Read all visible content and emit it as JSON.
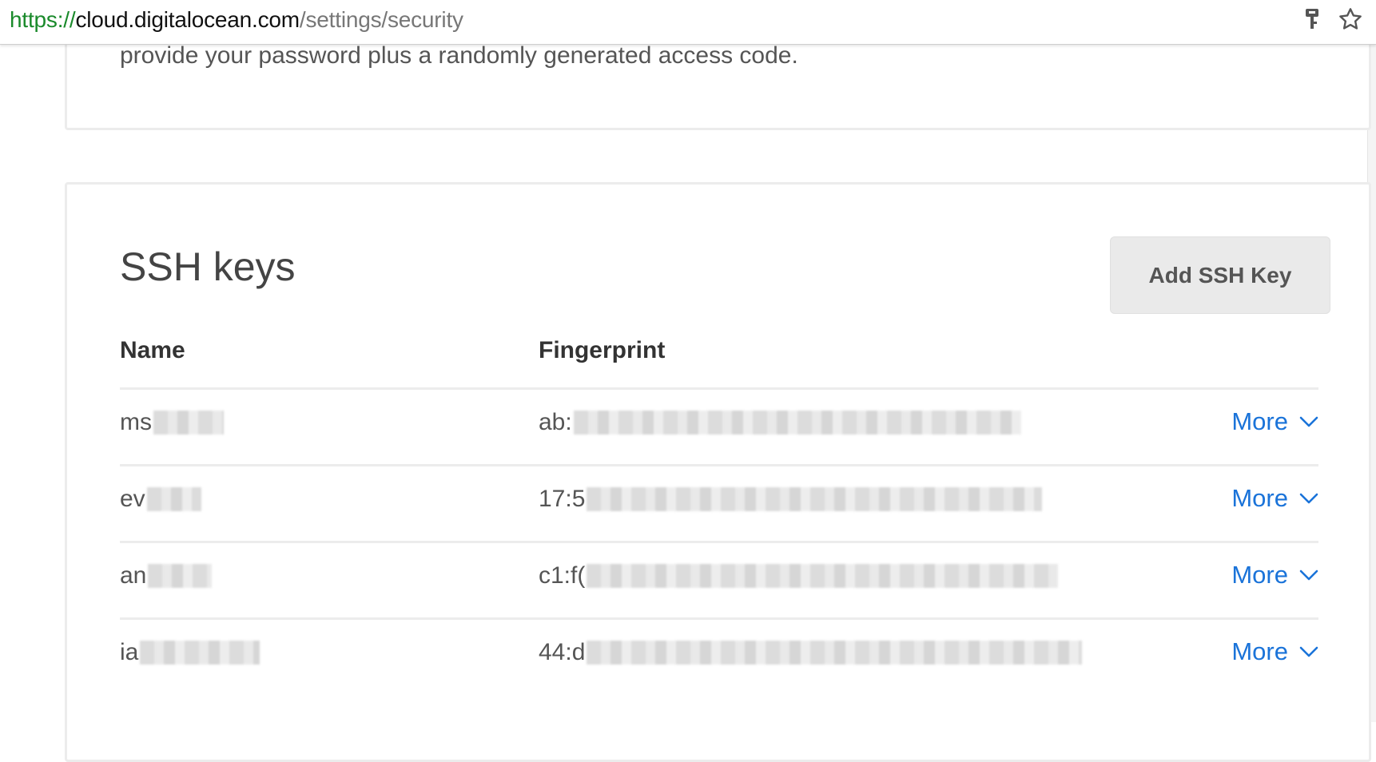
{
  "browser": {
    "url_scheme": "https://",
    "url_host": "cloud.digitalocean.com",
    "url_path": "/settings/security",
    "icons": [
      "key-icon",
      "star-icon"
    ]
  },
  "two_factor": {
    "description": "provide your password plus a randomly generated access code."
  },
  "ssh_keys": {
    "title": "SSH keys",
    "add_button_label": "Add SSH Key",
    "columns": [
      "Name",
      "Fingerprint"
    ],
    "rows": [
      {
        "name": "ms",
        "fingerprint": "ab:",
        "more_label": "More"
      },
      {
        "name": "ev",
        "fingerprint": "17:5",
        "more_label": "More"
      },
      {
        "name": "an",
        "fingerprint": "c1:f(",
        "more_label": "More"
      },
      {
        "name": "ia",
        "fingerprint": "44:d",
        "more_label": "More"
      }
    ]
  },
  "colors": {
    "link": "#1a73d9",
    "url_scheme": "#1a8a2b",
    "button_bg": "#eaeaea"
  }
}
